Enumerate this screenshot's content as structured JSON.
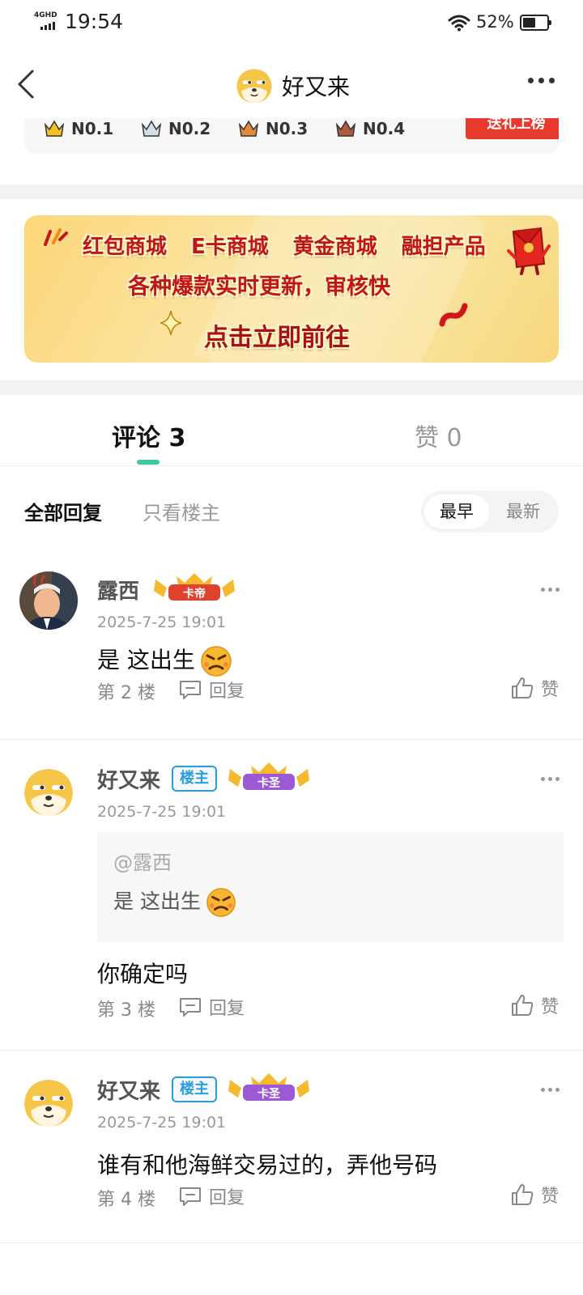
{
  "status_bar": {
    "network": "4GHD",
    "time": "19:54",
    "battery_text": "52%",
    "battery_level": 0.52
  },
  "nav": {
    "title": "好又来"
  },
  "ranks": {
    "items": [
      "N0.1",
      "N0.2",
      "N0.3",
      "N0.4"
    ],
    "gift_button": "送礼上榜"
  },
  "banner": {
    "line1": [
      "红包商城",
      "E卡商城",
      "黄金商城",
      "融担产品"
    ],
    "line2": "各种爆款实时更新，审核快",
    "cta": "点击立即前往"
  },
  "tabs": {
    "comments": "评论 3",
    "likes": "赞 0"
  },
  "filter": {
    "all": "全部回复",
    "op_only": "只看楼主",
    "sort_early": "最早",
    "sort_new": "最新"
  },
  "comments": [
    {
      "user": "露西",
      "level": "卡帝",
      "time": "2025-7-25 19:01",
      "text": "是 这出生",
      "floor": "第 2 楼",
      "reply": "回复",
      "like": "赞"
    },
    {
      "user": "好又来",
      "op_badge": "楼主",
      "level": "卡圣",
      "time": "2025-7-25 19:01",
      "quote_user": "@露西",
      "quote_text": "是 这出生",
      "text": "你确定吗",
      "floor": "第 3 楼",
      "reply": "回复",
      "like": "赞"
    },
    {
      "user": "好又来",
      "op_badge": "楼主",
      "level": "卡圣",
      "time": "2025-7-25 19:01",
      "text": "谁有和他海鲜交易过的，弄他号码",
      "floor": "第 4 楼",
      "reply": "回复",
      "like": "赞"
    }
  ],
  "colors": {
    "accent": "#3cc8a0",
    "badge_blue": "#2d9cdb",
    "gift_red": "#e8392f",
    "banner_text": "#c0161a"
  }
}
